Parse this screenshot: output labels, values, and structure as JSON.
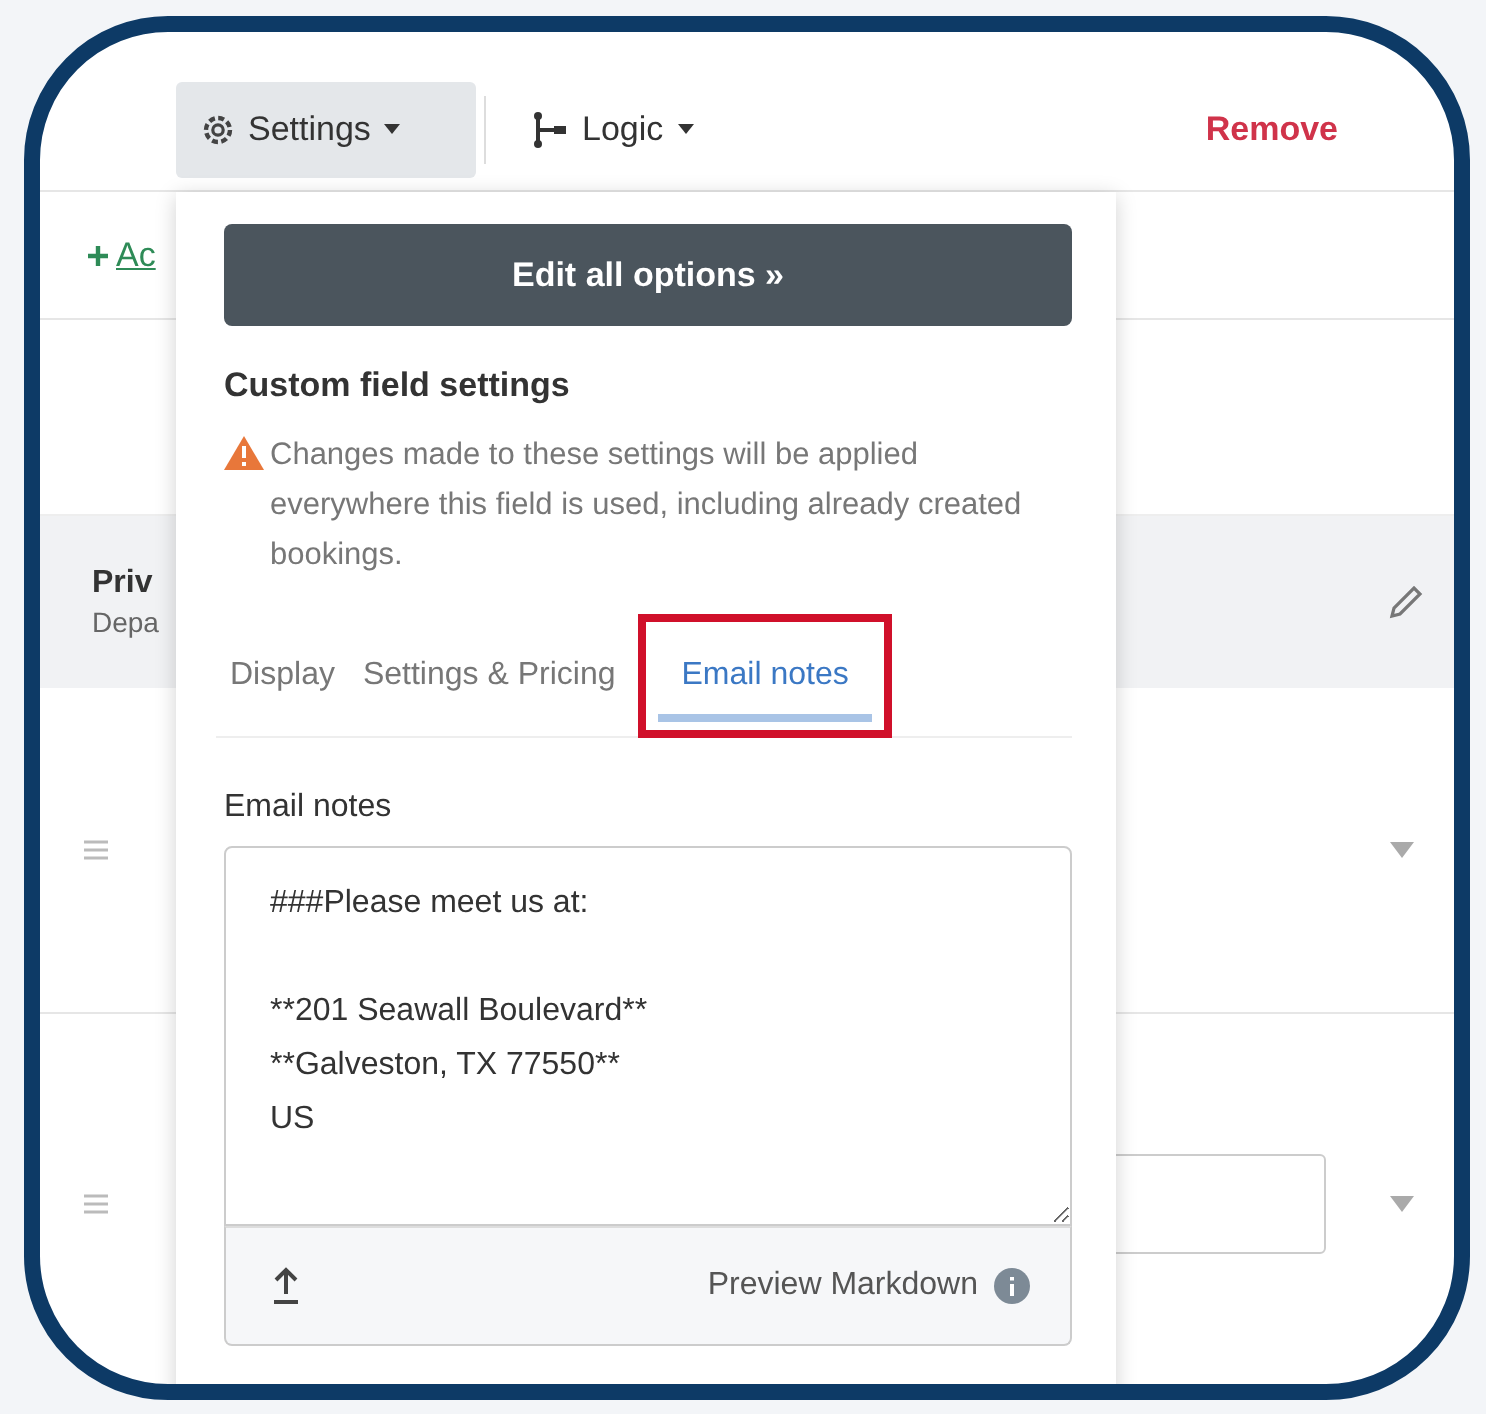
{
  "toolbar": {
    "settings_button": "Settings",
    "logic_button": "Logic",
    "remove_link": "Remove"
  },
  "background": {
    "add_link": "Ac",
    "section": {
      "title": "Priv",
      "subtitle": "Depa"
    }
  },
  "panel": {
    "edit_button": "Edit all options »",
    "heading": "Custom field settings",
    "warning": "Changes made to these settings will be applied everywhere this field is used, including already created bookings.",
    "tabs": [
      {
        "label": "Display",
        "selected": false,
        "highlighted": false
      },
      {
        "label": "Settings & Pricing",
        "selected": false,
        "highlighted": false
      },
      {
        "label": "Email notes",
        "selected": true,
        "highlighted": true
      }
    ],
    "notes_label": "Email notes",
    "notes_value": "###Please meet us at:\n\n**201 Seawall Boulevard**\n**Galveston, TX 77550**\nUS",
    "preview_link": "Preview Markdown"
  }
}
